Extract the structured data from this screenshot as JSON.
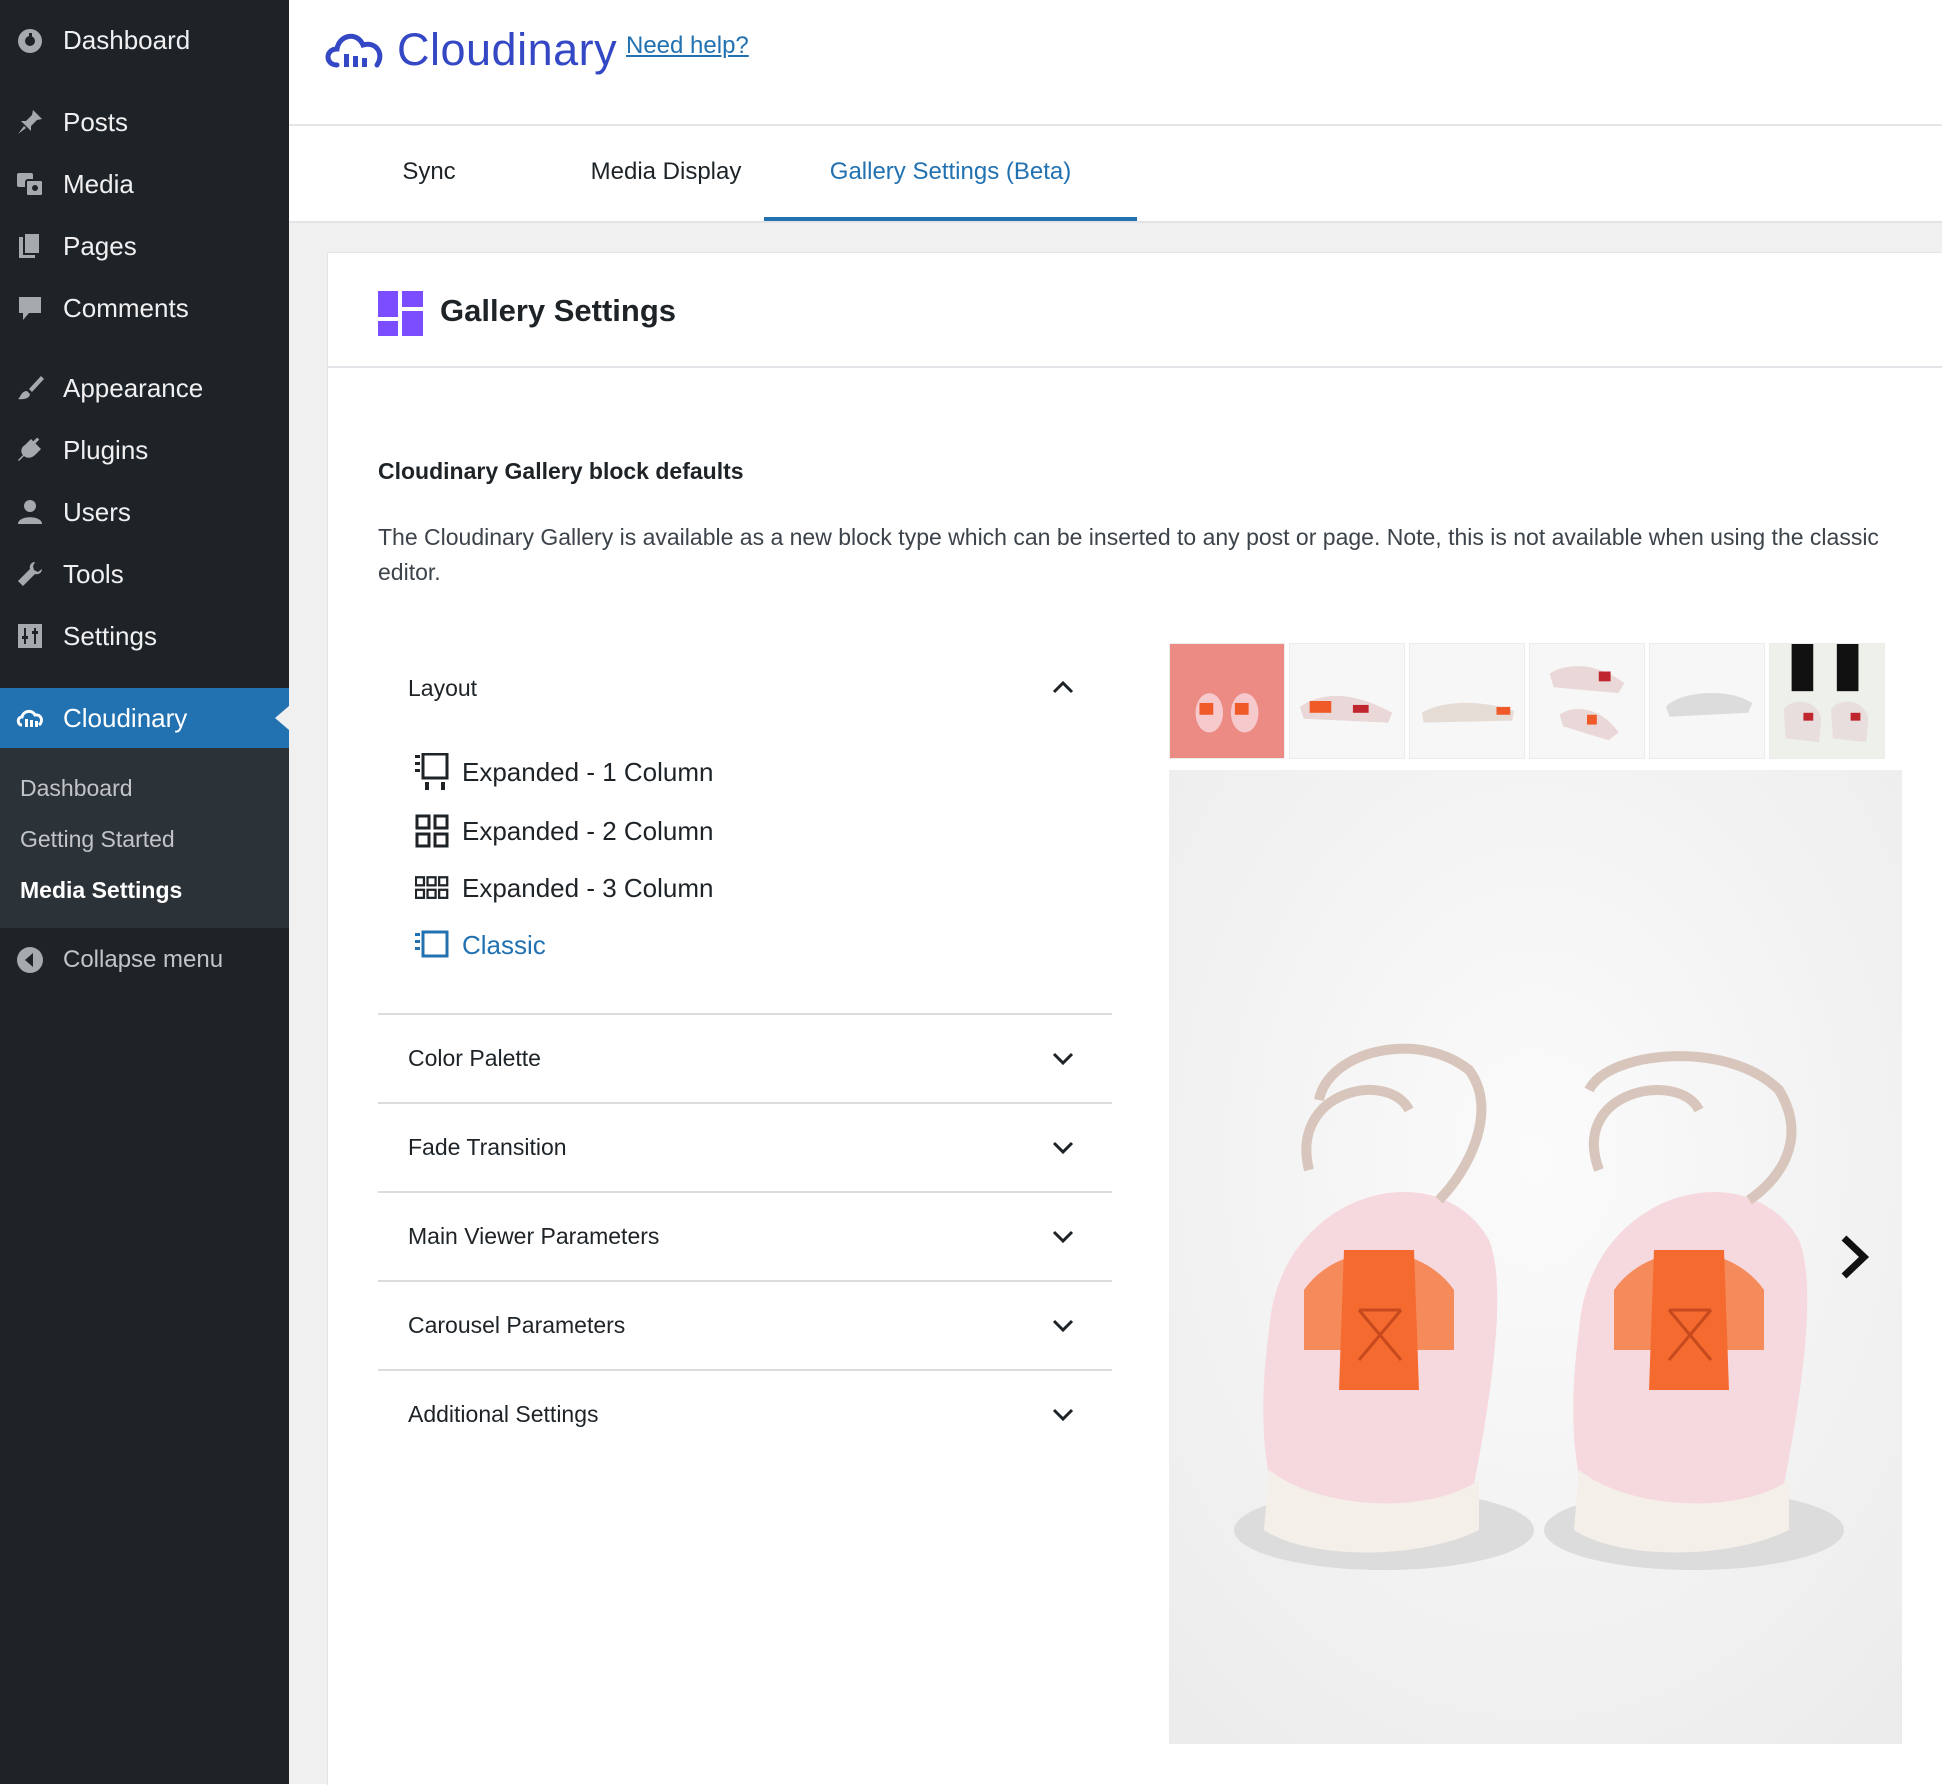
{
  "sidebar": {
    "items": [
      {
        "label": "Dashboard",
        "icon": "dashboard-icon"
      },
      {
        "label": "Posts",
        "icon": "pin-icon"
      },
      {
        "label": "Media",
        "icon": "media-icon"
      },
      {
        "label": "Pages",
        "icon": "pages-icon"
      },
      {
        "label": "Comments",
        "icon": "comment-icon"
      },
      {
        "label": "Appearance",
        "icon": "brush-icon"
      },
      {
        "label": "Plugins",
        "icon": "plug-icon"
      },
      {
        "label": "Users",
        "icon": "user-icon"
      },
      {
        "label": "Tools",
        "icon": "wrench-icon"
      },
      {
        "label": "Settings",
        "icon": "settings-icon"
      },
      {
        "label": "Cloudinary",
        "icon": "cloudinary-icon",
        "active": true
      }
    ],
    "submenu": [
      {
        "label": "Dashboard"
      },
      {
        "label": "Getting Started"
      },
      {
        "label": "Media Settings",
        "current": true
      }
    ],
    "collapse_label": "Collapse menu"
  },
  "header": {
    "logo_text": "Cloudinary",
    "help_link": "Need help?"
  },
  "tabs": [
    {
      "label": "Sync"
    },
    {
      "label": "Media Display"
    },
    {
      "label": "Gallery Settings (Beta)",
      "active": true
    }
  ],
  "panel": {
    "title": "Gallery Settings",
    "section_title": "Cloudinary Gallery block defaults",
    "section_desc": "The Cloudinary Gallery is available as a new block type which can be inserted to any post or page. Note, this is not available when using the classic editor."
  },
  "accordion": {
    "layout": {
      "label": "Layout",
      "expanded": true,
      "options": [
        {
          "label": "Expanded - 1 Column",
          "icon": "expanded-1-column-icon"
        },
        {
          "label": "Expanded - 2 Column",
          "icon": "expanded-2-column-icon"
        },
        {
          "label": "Expanded - 3 Column",
          "icon": "expanded-3-column-icon"
        },
        {
          "label": "Classic",
          "icon": "classic-layout-icon",
          "selected": true
        }
      ]
    },
    "sections": [
      {
        "label": "Color Palette"
      },
      {
        "label": "Fade Transition"
      },
      {
        "label": "Main Viewer Parameters"
      },
      {
        "label": "Carousel Parameters"
      },
      {
        "label": "Additional Settings"
      }
    ]
  },
  "gallery": {
    "thumbnail_count": 6,
    "selected_thumbnail": 1
  },
  "colors": {
    "sidebar_bg": "#1d2327",
    "active_blue": "#2271b1",
    "brand_blue": "#3448c5",
    "panel_icon_purple": "#7c4dff"
  }
}
